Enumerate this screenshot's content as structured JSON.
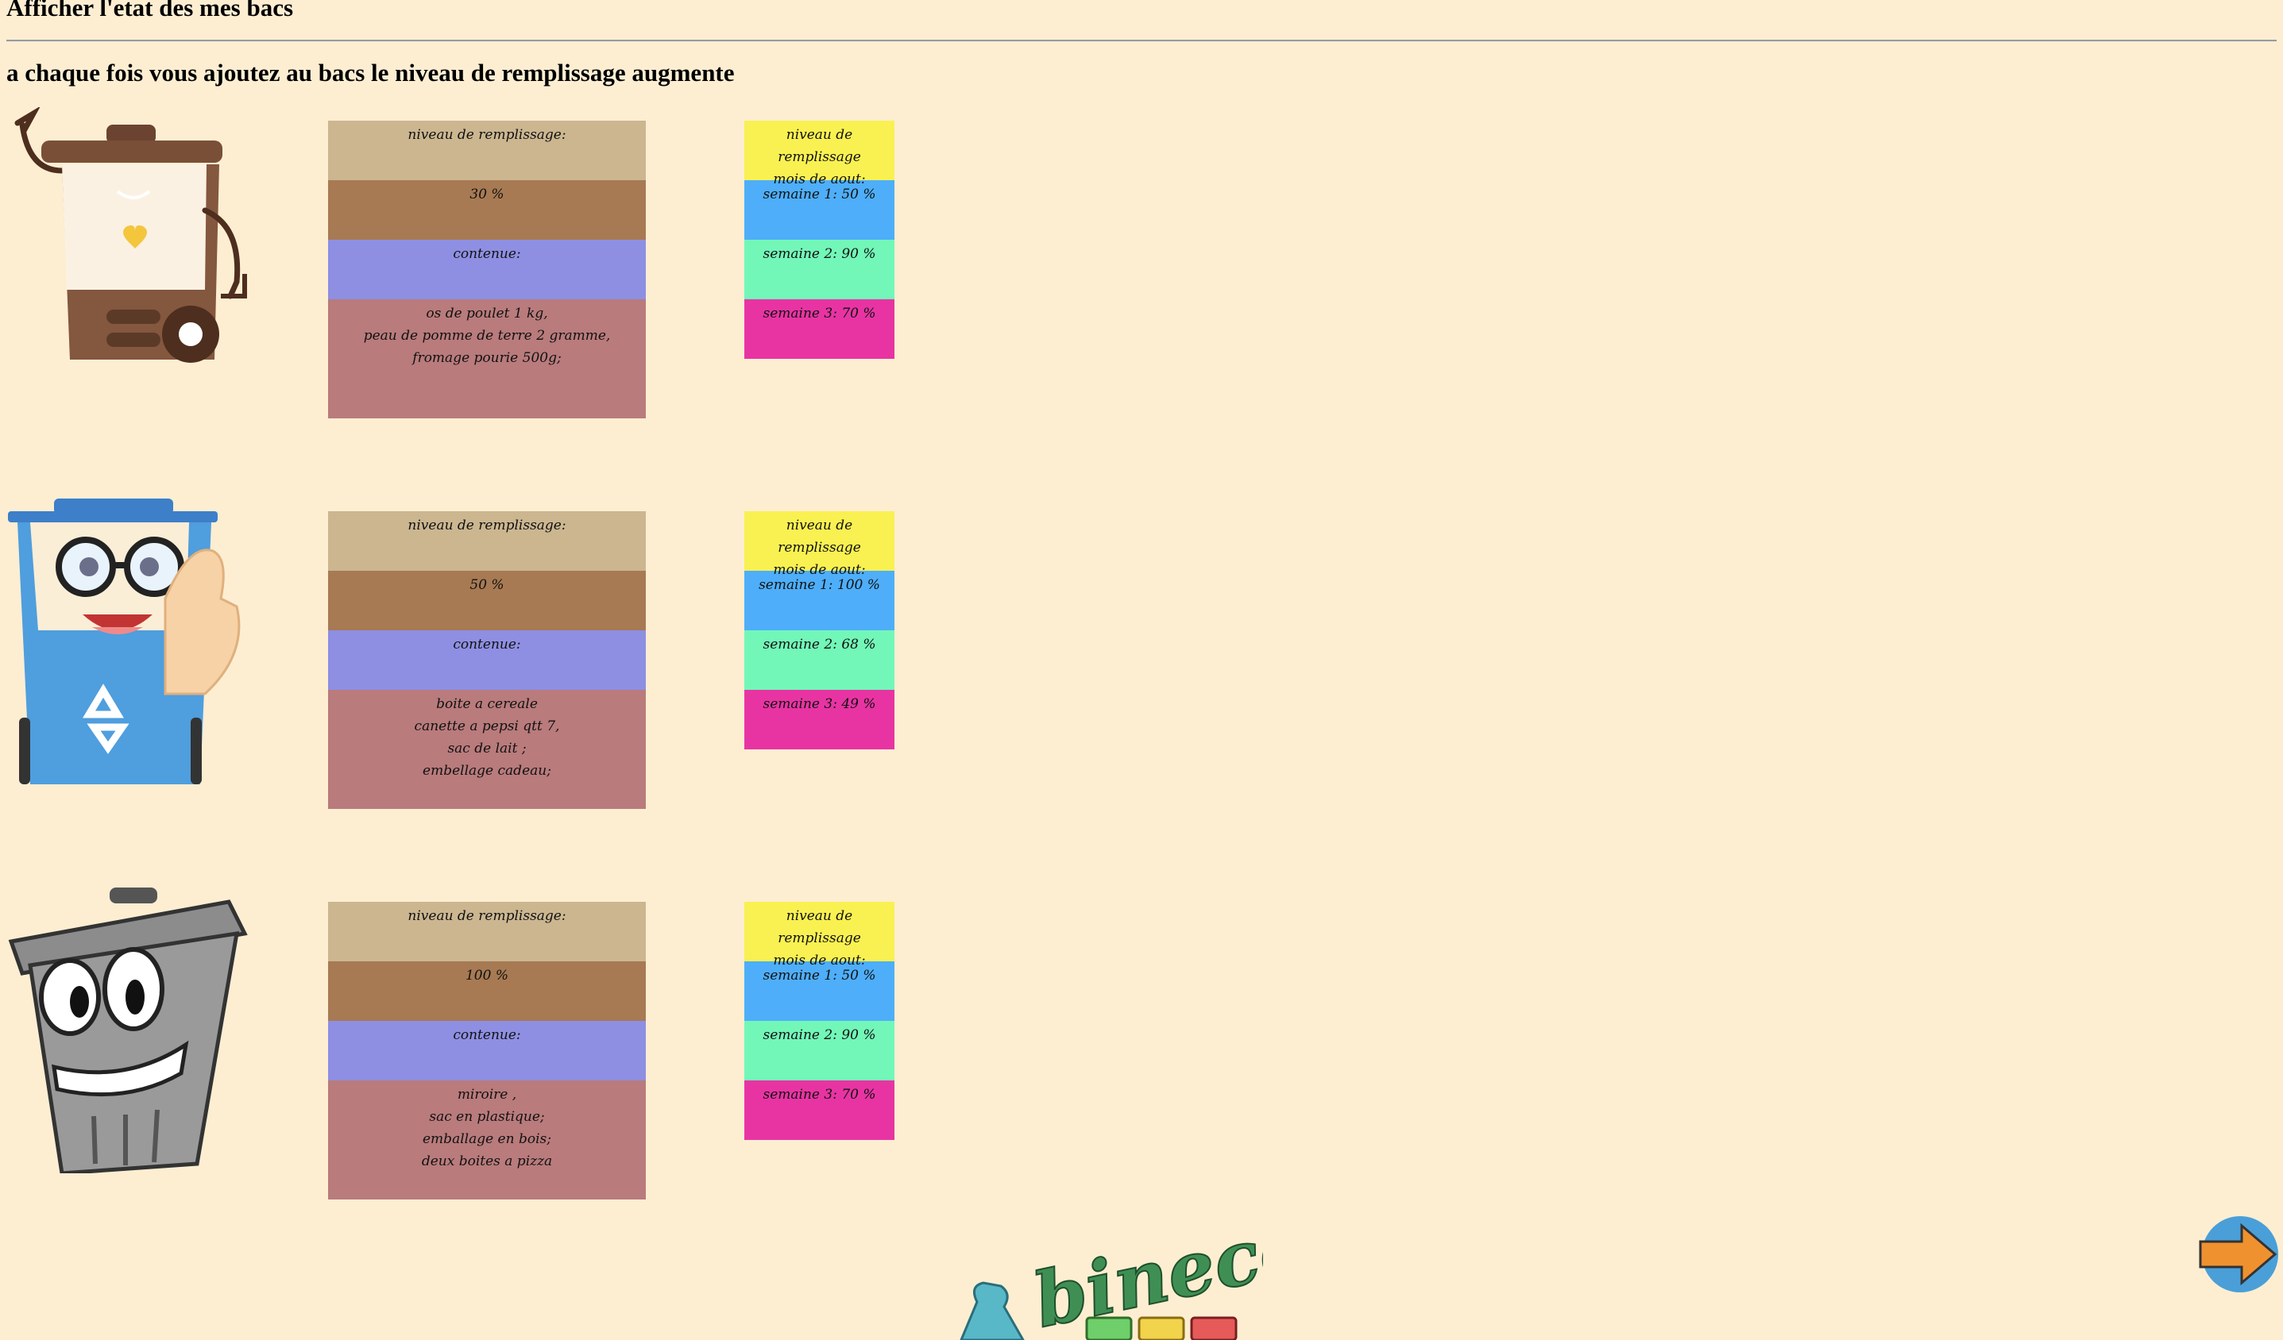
{
  "page": {
    "title": "Afficher l'etat des mes bacs",
    "subtitle": "a chaque fois vous ajoutez au bacs le niveau de remplissage augmente"
  },
  "bins": [
    {
      "image": "brown-compost-bin-mascot",
      "fill_label": "niveau de remplissage:",
      "fill_value": "30 %",
      "content_label": "contenue:",
      "content_lines": [
        "os de poulet 1 kg,",
        "peau de pomme de terre 2 gramme,",
        "fromage pourie 500g;"
      ],
      "month_label_1": "niveau de remplissage",
      "month_label_2": "mois de aout:",
      "weeks": [
        "semaine 1: 50 %",
        "semaine 2: 90 %",
        "semaine 3: 70 %"
      ]
    },
    {
      "image": "blue-recycling-bin-mascot",
      "fill_label": "niveau de remplissage:",
      "fill_value": "50 %",
      "content_label": "contenue:",
      "content_lines": [
        "boite a cereale",
        "canette a pepsi qtt 7,",
        "sac de lait ;",
        "embellage cadeau;"
      ],
      "month_label_1": "niveau de remplissage",
      "month_label_2": "mois de aout:",
      "weeks": [
        "semaine 1: 100 %",
        "semaine 2: 68 %",
        "semaine 3: 49 %"
      ]
    },
    {
      "image": "grey-trash-can-mascot",
      "fill_label": "niveau de remplissage:",
      "fill_value": "100 %",
      "content_label": "contenue:",
      "content_lines": [
        "miroire ,",
        "sac en plastique;",
        "emballage en bois;",
        "deux boites a pizza"
      ],
      "month_label_1": "niveau de remplissage",
      "month_label_2": "mois de aout:",
      "weeks": [
        "semaine 1: 50 %",
        "semaine 2: 90 %",
        "semaine 3: 70 %"
      ]
    }
  ],
  "footer": {
    "logo_text": "bineco",
    "next_icon": "arrow-right-icon"
  },
  "colors": {
    "background": "#fdeed2",
    "row_label": "#cbb690",
    "row_value": "#a77a53",
    "row_content_label": "#8e8fe2",
    "row_content": "#b97b7c",
    "month_header": "#f9f151",
    "week1": "#4eaef9",
    "week2": "#72f7b8",
    "week3": "#e834a3",
    "logo_green": "#3f8f54"
  }
}
